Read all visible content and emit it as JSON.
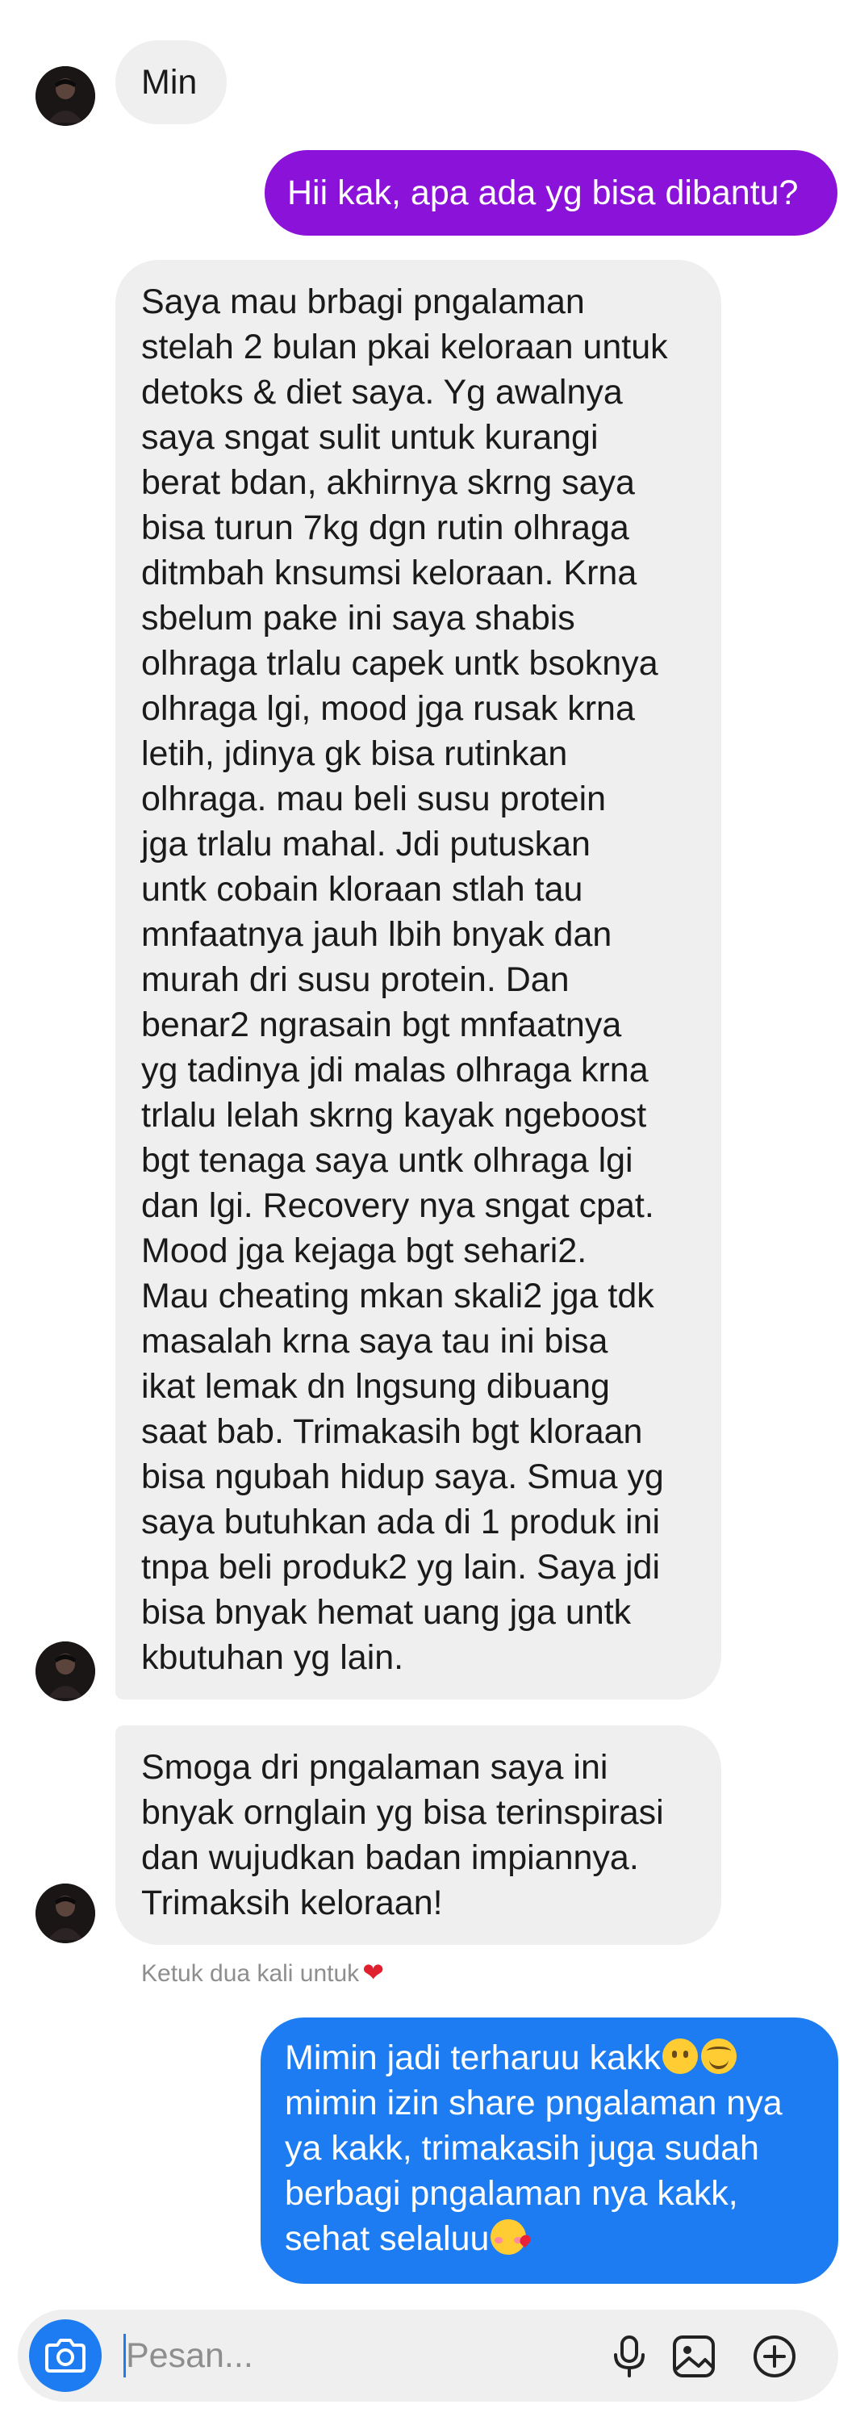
{
  "conversation": {
    "messages": [
      {
        "id": "m1",
        "direction": "incoming",
        "text": "Min"
      },
      {
        "id": "m2",
        "direction": "outgoing",
        "text": "Hii kak, apa ada yg bisa dibantu?"
      },
      {
        "id": "m3",
        "direction": "incoming",
        "text": "Saya mau brbagi pngalaman\nstelah 2 bulan pkai keloraan untuk\ndetoks & diet saya. Yg awalnya\nsaya sngat sulit untuk kurangi\nberat bdan, akhirnya skrng saya\nbisa turun 7kg dgn rutin olhraga\nditmbah knsumsi keloraan. Krna\nsbelum pake ini saya shabis\nolhraga trlalu capek untk bsoknya\nolhraga lgi, mood jga rusak krna\nletih, jdinya gk bisa rutinkan\nolhraga. mau beli susu protein\njga trlalu mahal. Jdi putuskan\nuntk cobain kloraan stlah tau\nmnfaatnya jauh lbih bnyak dan\nmurah dri susu protein. Dan\nbenar2 ngrasain bgt mnfaatnya\nyg tadinya jdi malas olhraga krna\ntrlalu lelah skrng kayak ngeboost\nbgt tenaga saya untk olhraga lgi\ndan lgi. Recovery nya sngat cpat.\nMood jga kejaga bgt sehari2.\nMau cheating mkan skali2 jga tdk\nmasalah krna saya tau ini bisa\nikat lemak dn lngsung dibuang\nsaat bab. Trimakasih bgt kloraan\nbisa ngubah hidup saya. Smua yg\nsaya butuhkan ada di 1 produk ini\ntnpa beli produk2 yg lain. Saya jdi\nbisa bnyak hemat uang jga untk\nkbutuhan yg lain."
      },
      {
        "id": "m4",
        "direction": "incoming",
        "text": "Smoga dri pngalaman saya ini\nbnyak ornglain yg bisa terinspirasi\ndan wujudkan badan impiannya.\nTrimaksih keloraan!"
      },
      {
        "id": "m5",
        "direction": "outgoing",
        "line1": "Mimin jadi terharuu kakk",
        "line2": "mimin izin share pngalaman nya\nya kakk, trimakasih juga sudah\nberbagi pngalaman nya kakk,\nsehat selaluu"
      }
    ],
    "double_tap_hint": "Ketuk dua kali untuk"
  },
  "composer": {
    "placeholder": "Pesan...",
    "icons": {
      "camera": "camera-icon",
      "mic": "microphone-icon",
      "gallery": "gallery-icon",
      "add": "plus-circle-icon"
    }
  },
  "colors": {
    "outgoing_purple": "#8b12d8",
    "outgoing_blue": "#1d7cf2",
    "incoming_bg": "#efefef",
    "hint_text": "#8e8e8e",
    "heart": "#e0202e"
  }
}
